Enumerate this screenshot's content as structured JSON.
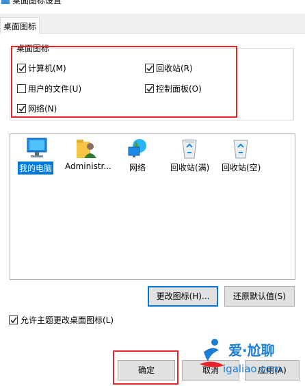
{
  "window": {
    "title": "桌面图标设置"
  },
  "tabs": [
    {
      "label": "桌面图标"
    }
  ],
  "group": {
    "title": "桌面图标",
    "checkboxes": [
      {
        "label": "计算机(M)",
        "checked": true
      },
      {
        "label": "回收站(R)",
        "checked": true
      },
      {
        "label": "用户的文件(U)",
        "checked": false
      },
      {
        "label": "控制面板(O)",
        "checked": true
      },
      {
        "label": "网络(N)",
        "checked": true
      }
    ]
  },
  "icons": [
    {
      "label": "我的电脑",
      "icon": "computer-icon",
      "selected": true
    },
    {
      "label": "Administr...",
      "icon": "user-folder-icon",
      "selected": false
    },
    {
      "label": "网络",
      "icon": "network-icon",
      "selected": false
    },
    {
      "label": "回收站(满)",
      "icon": "recycle-bin-full-icon",
      "selected": false
    },
    {
      "label": "回收站(空)",
      "icon": "recycle-bin-empty-icon",
      "selected": false
    }
  ],
  "buttons": {
    "change_icon": "更改图标(H)...",
    "restore_default": "还原默认值(S)",
    "ok": "确定",
    "cancel": "取消",
    "apply": "应用(A)"
  },
  "allow_themes": {
    "label": "允许主题更改桌面图标(L)",
    "checked": true
  },
  "watermark": {
    "brand": "爱·尬聊",
    "url": "igaliao.com"
  },
  "colors": {
    "accent": "#0078d7",
    "highlight_box": "#e8232a"
  }
}
